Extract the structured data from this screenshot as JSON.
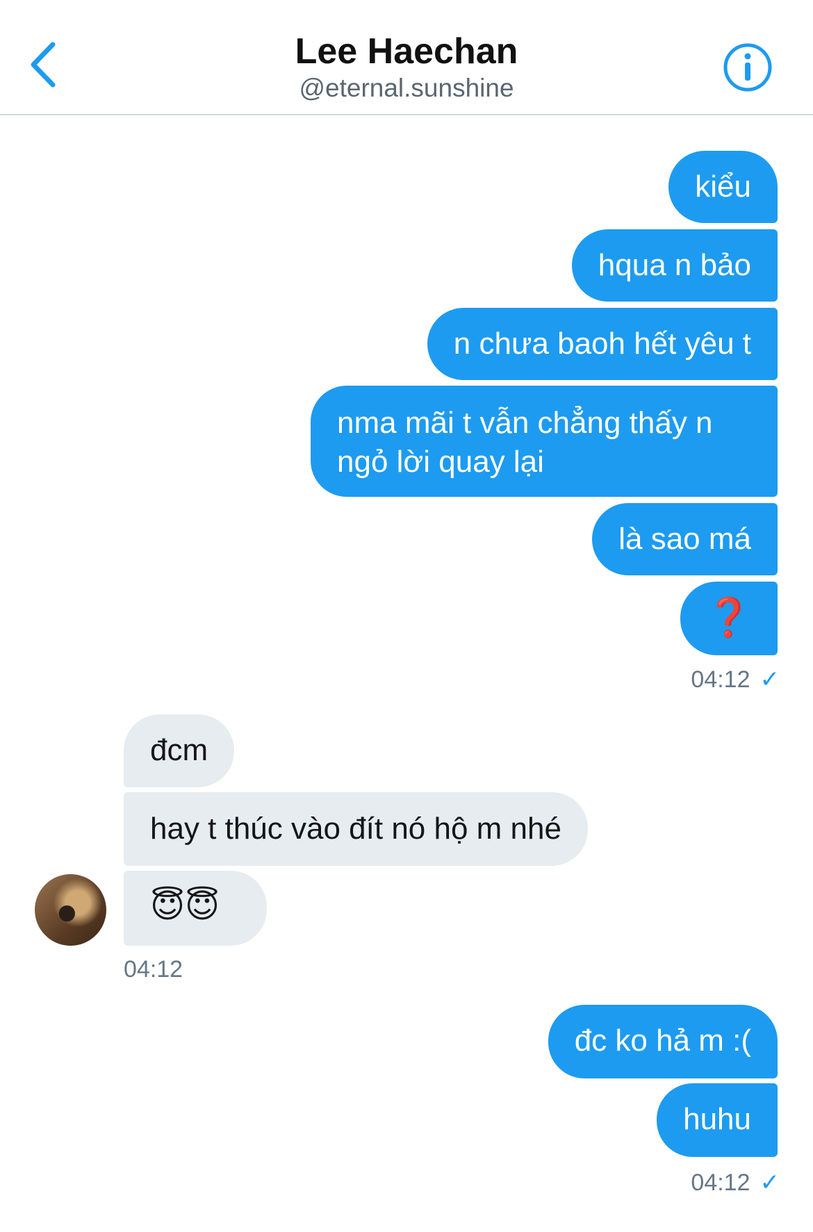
{
  "header": {
    "title": "Lee Haechan",
    "handle": "@eternal.sunshine"
  },
  "messages_group1": [
    "kiểu",
    "hqua n bảo",
    "n chưa baoh hết yêu t",
    "nma mãi t vẫn chẳng thấy n ngỏ lời quay lại",
    "là sao má",
    "❓"
  ],
  "time1": "04:12",
  "messages_group2": [
    "đcm",
    "hay t thúc vào đít nó hộ m nhé",
    "😇😇"
  ],
  "time2": "04:12",
  "messages_group3": [
    "đc ko hả m :(",
    "huhu"
  ],
  "time3": "04:12",
  "colors": {
    "accent": "#1d9bf0",
    "incoming": "#e6ecf0"
  },
  "icons": {
    "back": "chevron-left-icon",
    "info": "info-icon",
    "read": "check-icon"
  }
}
